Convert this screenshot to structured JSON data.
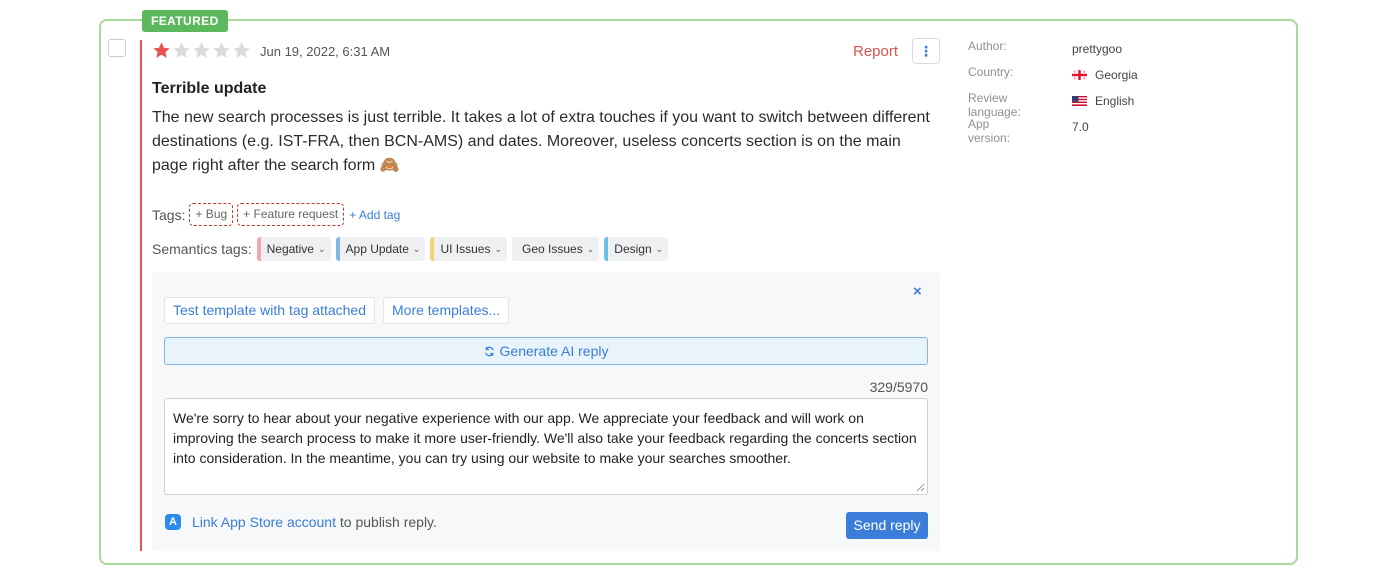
{
  "badge": "FEATURED",
  "review": {
    "rating": 1,
    "max_rating": 5,
    "date": "Jun 19, 2022, 6:31 AM",
    "title": "Terrible update",
    "body": "The new search processes is just terrible. It takes a lot of extra touches if you want to switch between different destinations (e.g. IST-FRA, then BCN-AMS) and dates. Moreover, useless concerts section is on the main page right after the search form 🙈"
  },
  "actions": {
    "report": "Report",
    "more_icon": "⋮"
  },
  "meta": {
    "author_label": "Author:",
    "author": "prettygoo",
    "country_label": "Country:",
    "country": "Georgia",
    "language_label": "Review language:",
    "language": "English",
    "version_label": "App version:",
    "version": "7.0"
  },
  "tags": {
    "label": "Tags:",
    "items": [
      "+ Bug",
      "+ Feature request"
    ],
    "add": "+ Add tag"
  },
  "semantic_tags": {
    "label": "Semantics tags:",
    "items": [
      {
        "label": "Negative",
        "color": "#f1a7ae",
        "bg": "#eef0f2"
      },
      {
        "label": "App Update",
        "color": "#7fb9e6",
        "bg": "#eef0f2"
      },
      {
        "label": "UI Issues",
        "color": "#f3d37a",
        "bg": "#eef0f2"
      },
      {
        "label": "Geo Issues",
        "color": "#eef0f2",
        "bg": "#eef0f2"
      },
      {
        "label": "Design",
        "color": "#6cc0e5",
        "bg": "#eef0f2"
      }
    ]
  },
  "reply": {
    "template_1": "Test template with tag attached",
    "template_2": "More templates...",
    "close": "×",
    "ai_button": "Generate AI reply",
    "counter": "329/5970",
    "text": "We're sorry to hear about your negative experience with our app. We appreciate your feedback and will work on improving the search process to make it more user-friendly. We'll also take your feedback regarding the concerts section into consideration. In the meantime, you can try using our website to make your searches smoother.",
    "link": "Link App Store account",
    "link_suffix": " to publish reply.",
    "send": "Send reply"
  },
  "colors": {
    "accent": "#3b7dd8",
    "danger": "#e55353",
    "featured": "#5cb85c",
    "card_border": "#a9d99c"
  }
}
